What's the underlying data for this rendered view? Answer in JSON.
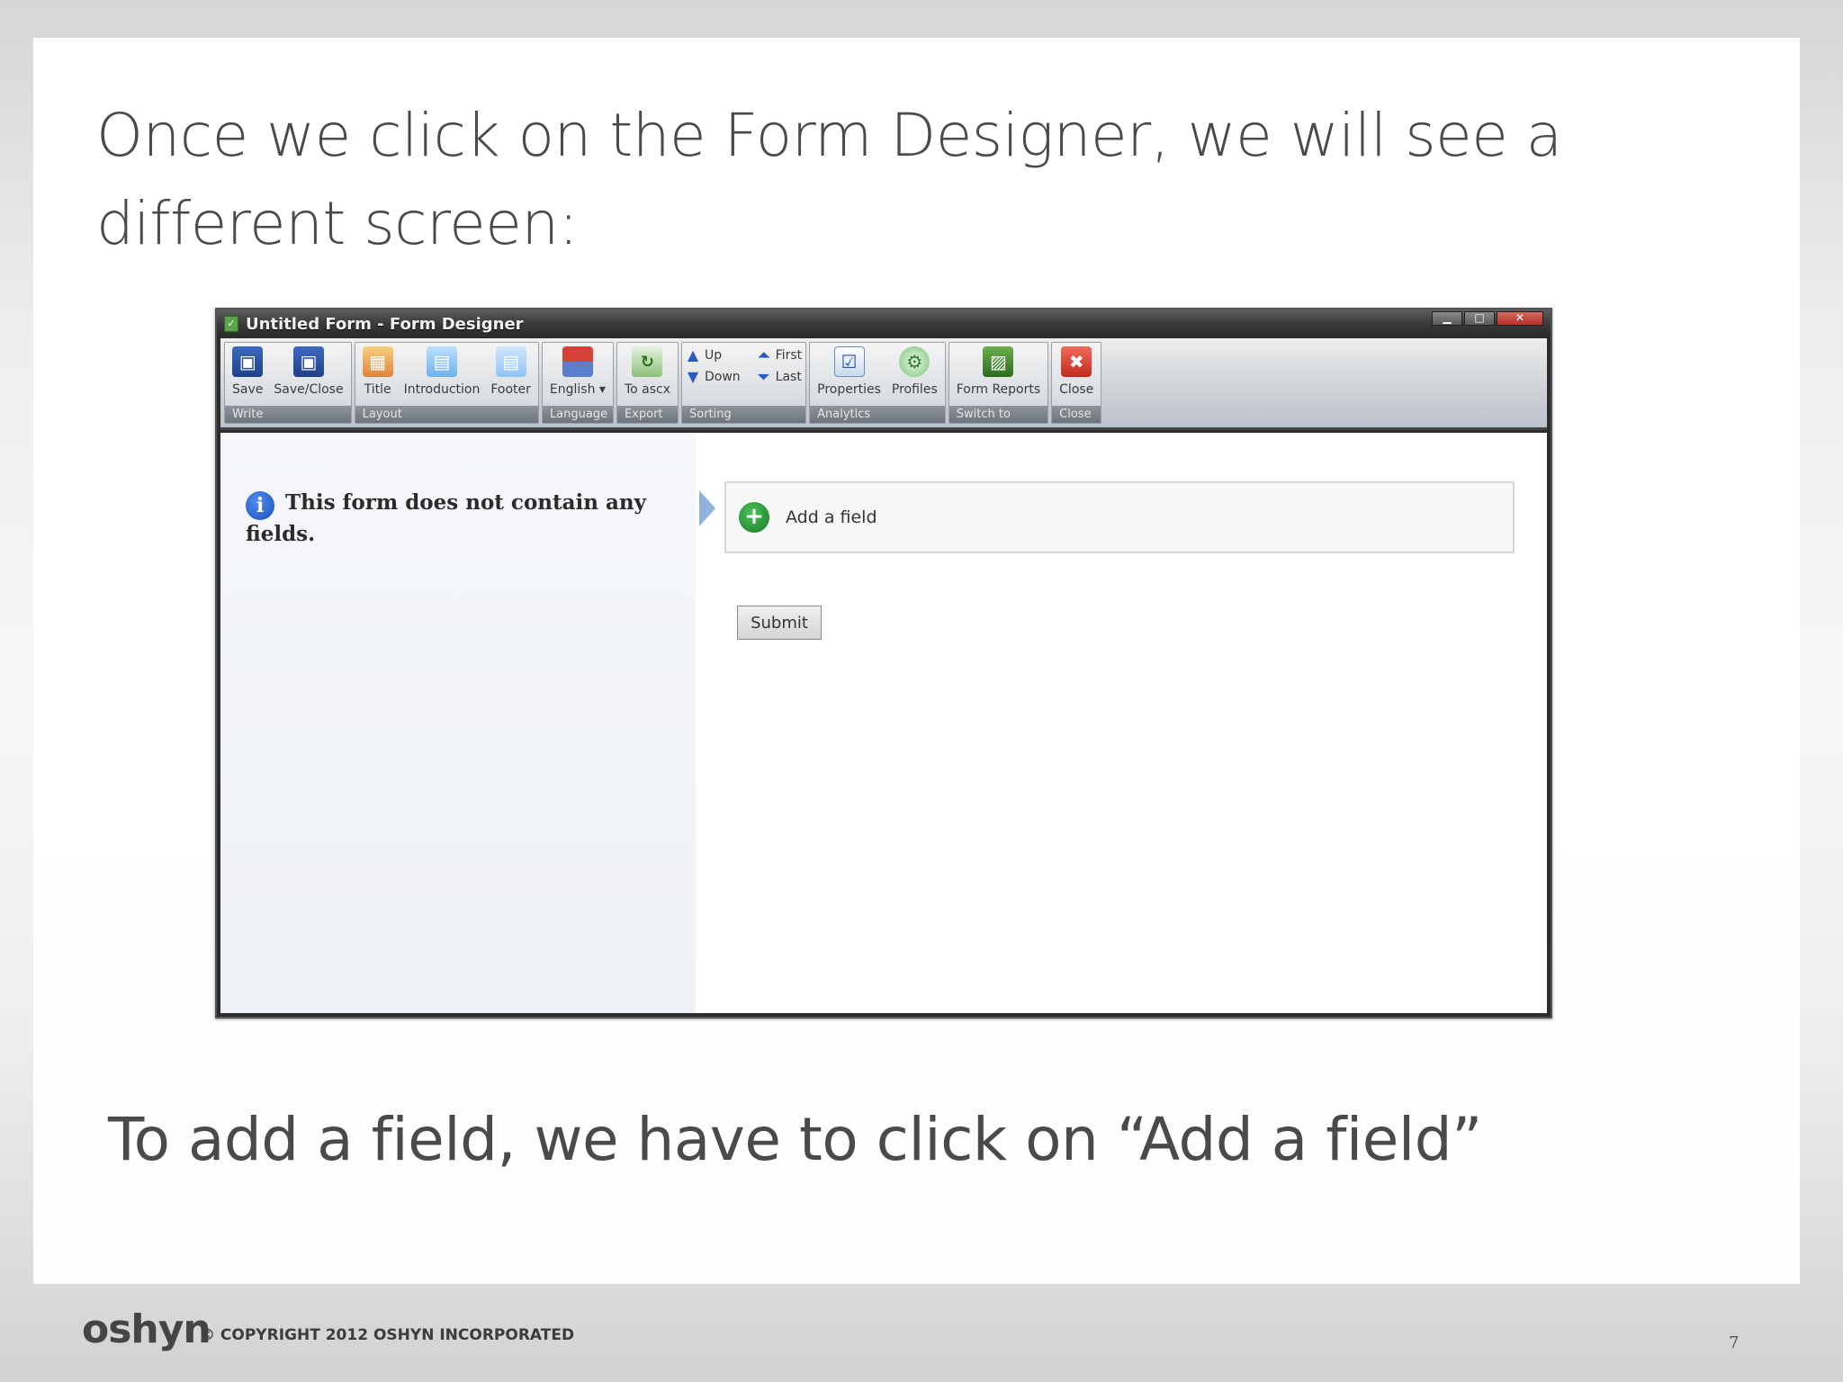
{
  "slide": {
    "heading": "Once we click on the Form Designer, we will see a different screen:",
    "bottom_text": "To add a field, we have to click on “Add a field”",
    "logo": "oshyn",
    "copyright": "© COPYRIGHT 2012 OSHYN INCORPORATED",
    "page_number": "7"
  },
  "window": {
    "title": "Untitled Form - Form Designer",
    "ribbon": {
      "groups": [
        {
          "label": "Write",
          "buttons": [
            {
              "label": "Save",
              "icon": "save-icon"
            },
            {
              "label": "Save/Close",
              "icon": "save-close-icon"
            }
          ]
        },
        {
          "label": "Layout",
          "buttons": [
            {
              "label": "Title",
              "icon": "title-icon"
            },
            {
              "label": "Introduction",
              "icon": "introduction-icon"
            },
            {
              "label": "Footer",
              "icon": "footer-icon"
            }
          ]
        },
        {
          "label": "Language",
          "buttons": [
            {
              "label": "English ▾",
              "icon": "flag-icon"
            }
          ]
        },
        {
          "label": "Export",
          "buttons": [
            {
              "label": "To ascx",
              "icon": "export-icon"
            }
          ]
        },
        {
          "label": "Sorting",
          "items": [
            {
              "label": "Up",
              "icon": "up-arrow-icon"
            },
            {
              "label": "Down",
              "icon": "down-arrow-icon"
            },
            {
              "label": "First",
              "icon": "first-icon"
            },
            {
              "label": "Last",
              "icon": "last-icon"
            }
          ]
        },
        {
          "label": "Analytics",
          "buttons": [
            {
              "label": "Properties",
              "icon": "properties-icon"
            },
            {
              "label": "Profiles",
              "icon": "profiles-icon"
            }
          ]
        },
        {
          "label": "Switch to",
          "buttons": [
            {
              "label": "Form Reports",
              "icon": "form-reports-icon"
            }
          ]
        },
        {
          "label": "Close",
          "buttons": [
            {
              "label": "Close",
              "icon": "close-icon"
            }
          ]
        }
      ]
    },
    "left_pane": {
      "message": "This form does not contain any fields."
    },
    "right_pane": {
      "add_field_label": "Add a field",
      "submit_label": "Submit"
    }
  },
  "colors": {
    "heading_text": "#4a4a4a",
    "titlebar": "#3a3a3a",
    "add_icon": "#1b7a24",
    "info_icon": "#1b4fb8"
  }
}
